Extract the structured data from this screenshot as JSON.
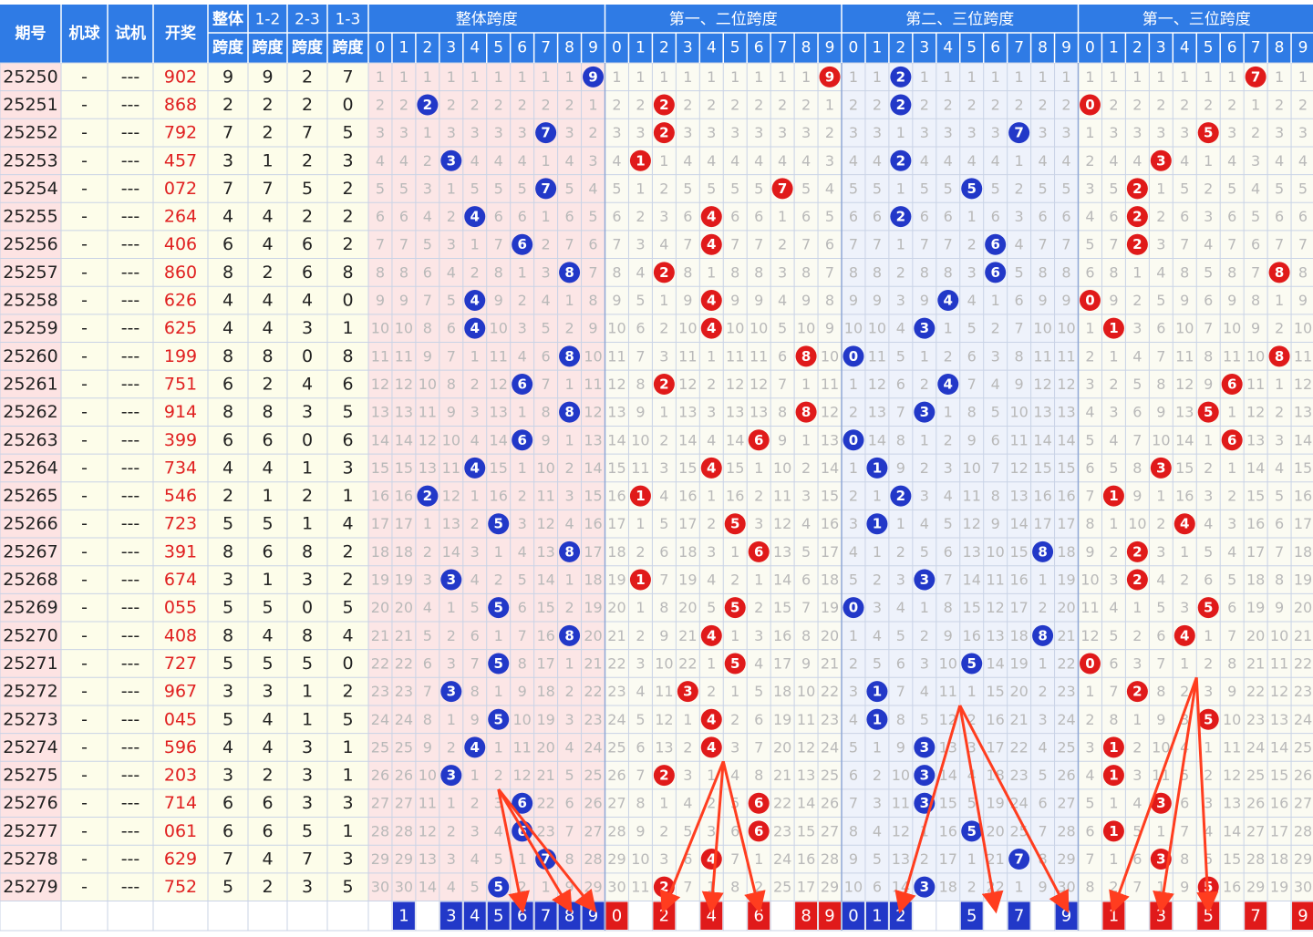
{
  "header": {
    "issue": "期号",
    "machine": "机球",
    "test": "试机",
    "draw": "开奖",
    "span_all_top": "整体",
    "span_all_bottom": "跨度",
    "span_12_top": "1-2",
    "span_23_top": "2-3",
    "span_13_top": "1-3",
    "span_bottom": "跨度",
    "group_all": "整体跨度",
    "group_12": "第一、二位跨度",
    "group_23": "第二、三位跨度",
    "group_13": "第一、三位跨度",
    "digits": [
      "0",
      "1",
      "2",
      "3",
      "4",
      "5",
      "6",
      "7",
      "8",
      "9"
    ]
  },
  "chart_data": {
    "type": "table",
    "columns": [
      "期号",
      "机球",
      "试机",
      "开奖",
      "整体跨度",
      "1-2跨度",
      "2-3跨度",
      "1-3跨度"
    ],
    "groups": [
      "整体跨度",
      "第一、二位跨度",
      "第二、三位跨度",
      "第一、三位跨度"
    ],
    "machine_placeholder": "-",
    "test_placeholder": "---",
    "rows": [
      {
        "issue": "25250",
        "draw": "902",
        "spans": [
          9,
          9,
          2,
          7
        ]
      },
      {
        "issue": "25251",
        "draw": "868",
        "spans": [
          2,
          2,
          2,
          0
        ]
      },
      {
        "issue": "25252",
        "draw": "792",
        "spans": [
          7,
          2,
          7,
          5
        ]
      },
      {
        "issue": "25253",
        "draw": "457",
        "spans": [
          3,
          1,
          2,
          3
        ]
      },
      {
        "issue": "25254",
        "draw": "072",
        "spans": [
          7,
          7,
          5,
          2
        ]
      },
      {
        "issue": "25255",
        "draw": "264",
        "spans": [
          4,
          4,
          2,
          2
        ]
      },
      {
        "issue": "25256",
        "draw": "406",
        "spans": [
          6,
          4,
          6,
          2
        ]
      },
      {
        "issue": "25257",
        "draw": "860",
        "spans": [
          8,
          2,
          6,
          8
        ]
      },
      {
        "issue": "25258",
        "draw": "626",
        "spans": [
          4,
          4,
          4,
          0
        ]
      },
      {
        "issue": "25259",
        "draw": "625",
        "spans": [
          4,
          4,
          3,
          1
        ]
      },
      {
        "issue": "25260",
        "draw": "199",
        "spans": [
          8,
          8,
          0,
          8
        ]
      },
      {
        "issue": "25261",
        "draw": "751",
        "spans": [
          6,
          2,
          4,
          6
        ]
      },
      {
        "issue": "25262",
        "draw": "914",
        "spans": [
          8,
          8,
          3,
          5
        ]
      },
      {
        "issue": "25263",
        "draw": "399",
        "spans": [
          6,
          6,
          0,
          6
        ]
      },
      {
        "issue": "25264",
        "draw": "734",
        "spans": [
          4,
          4,
          1,
          3
        ]
      },
      {
        "issue": "25265",
        "draw": "546",
        "spans": [
          2,
          1,
          2,
          1
        ]
      },
      {
        "issue": "25266",
        "draw": "723",
        "spans": [
          5,
          5,
          1,
          4
        ]
      },
      {
        "issue": "25267",
        "draw": "391",
        "spans": [
          8,
          6,
          8,
          2
        ]
      },
      {
        "issue": "25268",
        "draw": "674",
        "spans": [
          3,
          1,
          3,
          2
        ]
      },
      {
        "issue": "25269",
        "draw": "055",
        "spans": [
          5,
          5,
          0,
          5
        ]
      },
      {
        "issue": "25270",
        "draw": "408",
        "spans": [
          8,
          4,
          8,
          4
        ]
      },
      {
        "issue": "25271",
        "draw": "727",
        "spans": [
          5,
          5,
          5,
          0
        ]
      },
      {
        "issue": "25272",
        "draw": "967",
        "spans": [
          3,
          3,
          1,
          2
        ]
      },
      {
        "issue": "25273",
        "draw": "045",
        "spans": [
          5,
          4,
          1,
          5
        ]
      },
      {
        "issue": "25274",
        "draw": "596",
        "spans": [
          4,
          4,
          3,
          1
        ]
      },
      {
        "issue": "25275",
        "draw": "203",
        "spans": [
          3,
          2,
          3,
          1
        ]
      },
      {
        "issue": "25276",
        "draw": "714",
        "spans": [
          6,
          6,
          3,
          3
        ]
      },
      {
        "issue": "25277",
        "draw": "061",
        "spans": [
          6,
          6,
          5,
          1
        ]
      },
      {
        "issue": "25278",
        "draw": "629",
        "spans": [
          7,
          4,
          7,
          3
        ]
      },
      {
        "issue": "25279",
        "draw": "752",
        "spans": [
          5,
          2,
          3,
          5
        ]
      }
    ],
    "bottom_markers": [
      {
        "group": 0,
        "digits": [
          1,
          3,
          4,
          5,
          6,
          7,
          8,
          9
        ]
      },
      {
        "group": 1,
        "digits": [
          0,
          2,
          4,
          6,
          8,
          9
        ]
      },
      {
        "group": 2,
        "digits": [
          0,
          1,
          2,
          5,
          7,
          9
        ]
      },
      {
        "group": 3,
        "digits": [
          1,
          3,
          5,
          7,
          9
        ]
      }
    ],
    "arrows": [
      {
        "group": 0,
        "from_row": 26,
        "to_digit": 6
      },
      {
        "group": 0,
        "from_row": 26,
        "to_digit": 8
      },
      {
        "group": 0,
        "from_row": 26,
        "to_digit": 9
      },
      {
        "group": 1,
        "from_row": 25,
        "to_digit": 2
      },
      {
        "group": 1,
        "from_row": 25,
        "to_digit": 4
      },
      {
        "group": 1,
        "from_row": 25,
        "to_digit": 6
      },
      {
        "group": 2,
        "from_row": 23,
        "to_digit": 2
      },
      {
        "group": 2,
        "from_row": 23,
        "to_digit": 6
      },
      {
        "group": 2,
        "from_row": 23,
        "to_digit": 9
      },
      {
        "group": 3,
        "from_row": 22,
        "to_digit": 1
      },
      {
        "group": 3,
        "from_row": 22,
        "to_digit": 3
      },
      {
        "group": 3,
        "from_row": 22,
        "to_digit": 5
      }
    ]
  },
  "colors": {
    "header_bg": "#2f7be5",
    "header_text": "#ffffff",
    "row_bg": "#fdfdea",
    "issue_bg": "#fde3e3",
    "draw_text": "#e02020",
    "grid_line": "#c9d3e6",
    "omit_text": "#b9b9b9",
    "band_all": "#fce6e6",
    "band_12": "#fbfbf2",
    "band_23": "#eef2fb",
    "band_13": "#fbfbf2",
    "ball_blue": "#2238c8",
    "ball_red": "#e01a1a",
    "arrow": "#ff3d1f",
    "marker_blue": "#2238c8",
    "marker_red": "#e01a1a"
  }
}
